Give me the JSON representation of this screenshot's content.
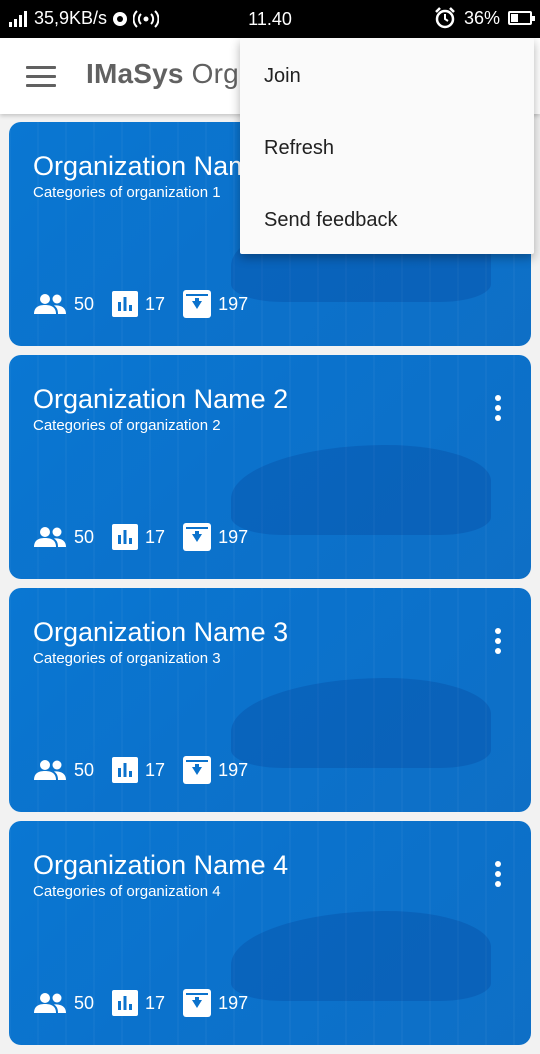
{
  "status_bar": {
    "network_speed": "35,9KB/s",
    "time": "11.40",
    "battery": "36%",
    "battery_level": 0.36,
    "icons": [
      "signal-icon",
      "sync-icon",
      "hotspot-icon",
      "alarm-icon",
      "battery-icon"
    ]
  },
  "app_bar": {
    "title_bold": "IMaSys",
    "title_rest": " Org",
    "menu_icon": "hamburger-menu-icon"
  },
  "menu": {
    "items": [
      {
        "label": "Join"
      },
      {
        "label": "Refresh"
      },
      {
        "label": "Send feedback"
      }
    ]
  },
  "cards": [
    {
      "name": "Organization Name 1",
      "category": "Categories of organization 1",
      "members": "50",
      "charts": "17",
      "downloads": "197"
    },
    {
      "name": "Organization Name 2",
      "category": "Categories of organization 2",
      "members": "50",
      "charts": "17",
      "downloads": "197"
    },
    {
      "name": "Organization Name 3",
      "category": "Categories of organization 3",
      "members": "50",
      "charts": "17",
      "downloads": "197"
    },
    {
      "name": "Organization Name 4",
      "category": "Categories of organization 4",
      "members": "50",
      "charts": "17",
      "downloads": "197"
    }
  ],
  "colors": {
    "card_blue": "#0b72cc",
    "status_bar": "#000000",
    "app_bar": "#ffffff",
    "title_gray": "#616161"
  }
}
